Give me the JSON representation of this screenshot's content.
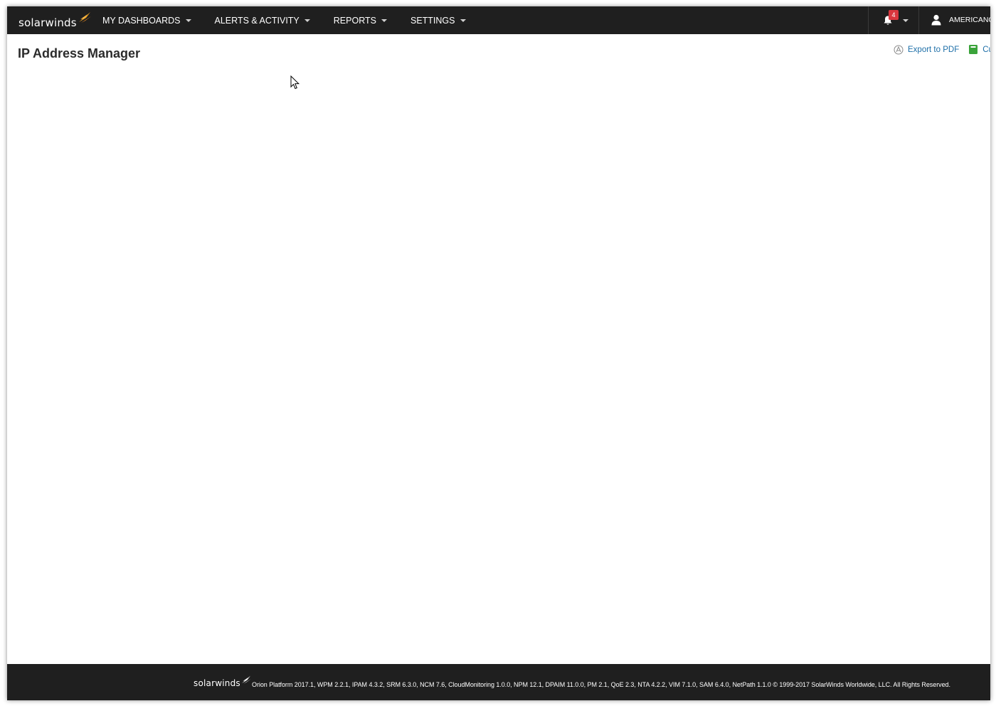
{
  "app": {
    "logo_text": "solarwinds",
    "accent_color": "#f5a623"
  },
  "nav": {
    "items": [
      {
        "label": "MY DASHBOARDS"
      },
      {
        "label": "ALERTS & ACTIVITY"
      },
      {
        "label": "REPORTS"
      },
      {
        "label": "SETTINGS"
      }
    ]
  },
  "notifications": {
    "count": "4",
    "icon": "bell-icon",
    "badge_color": "#d9363e"
  },
  "user": {
    "name": "AMERICANC",
    "icon": "user-icon"
  },
  "page": {
    "title": "IP Address Manager"
  },
  "actions": {
    "export_label": "Export to PDF",
    "customize_label": "Cu"
  },
  "footer": {
    "logo_text": "solarwinds",
    "text": "Orion Platform 2017.1, WPM 2.2.1, IPAM 4.3.2, SRM 6.3.0, NCM 7.6, CloudMonitoring 1.0.0, NPM 12.1, DPAIM 11.0.0, PM 2.1, QoE 2.3, NTA 4.2.2, VIM 7.1.0, SAM 6.4.0, NetPath 1.1.0 © 1999-2017 SolarWinds Worldwide, LLC. All Rights Reserved."
  }
}
